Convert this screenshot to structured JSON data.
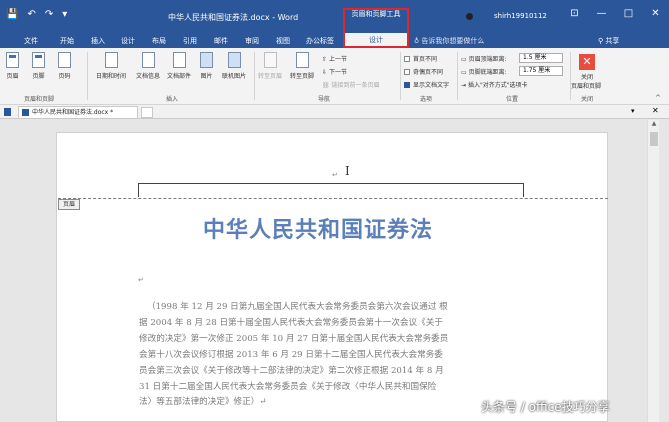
{
  "titlebar": {
    "doc_title": "中华人民共和国证券法.docx - Word",
    "context_group": "页眉和页脚工具",
    "user": "shirh19910112",
    "qat": {
      "save_icon": "💾",
      "undo_icon": "↶",
      "redo_icon": "↷",
      "customize_icon": "▾"
    },
    "win": {
      "ribbon_opt": "⊡",
      "minimize": "—",
      "maximize": "□",
      "close": "✕"
    }
  },
  "tabs": {
    "file": "文件",
    "home": "开始",
    "insert": "插入",
    "design_main": "设计",
    "layout": "布局",
    "references": "引用",
    "mailings": "邮件",
    "review": "审阅",
    "view": "视图",
    "office_tab": "办公标签",
    "design_ctx": "设计",
    "tellme": "告诉我你想要做什么",
    "share": "共享"
  },
  "ribbon": {
    "header_footer": {
      "header": "页眉",
      "footer": "页脚",
      "page_number": "页码",
      "group": "页眉和页脚"
    },
    "insert": {
      "datetime": "日期和时间",
      "docinfo": "文档信息",
      "docparts": "文档部件",
      "picture": "图片",
      "online_picture": "联机图片",
      "group": "插入"
    },
    "nav": {
      "goto_header": "转至页眉",
      "goto_footer": "转至页脚",
      "prev": "上一节",
      "next": "下一节",
      "link_prev": "链接到前一条页眉",
      "group": "导航"
    },
    "options": {
      "diff_first": "首页不同",
      "diff_odd_even": "奇偶页不同",
      "show_text": "显示文档文字",
      "group": "选项"
    },
    "position": {
      "header_top": "页眉顶端距离:",
      "header_top_val": "1.5 厘米",
      "footer_bottom": "页脚底端距离:",
      "footer_bottom_val": "1.75 厘米",
      "align_tab": "插入\"对齐方式\"选项卡",
      "group": "位置"
    },
    "close": {
      "label1": "关闭",
      "label2": "页眉和页脚",
      "group": "关闭"
    },
    "collapse": "^"
  },
  "doctabs": {
    "active": "中华人民共和国证券法.docx *",
    "menu": "▾",
    "close": "✕"
  },
  "document": {
    "header_label": "页眉",
    "cursor": "I",
    "para_mark": "↵",
    "heading": "中华人民共和国证券法",
    "body_lines": [
      "（1998 年 12 月 29 日第九届全国人民代表大会常务委员会第六次会议通过  根",
      "据 2004 年 8 月 28 日第十届全国人民代表大会常务委员会第十一次会议《关于",
      "修改的决定》第一次修正 2005 年 10 月 27 日第十届全国人民代表大会常务委员",
      "会第十八次会议修订根据 2013 年 6 月 29 日第十二届全国人民代表大会常务委",
      "员会第三次会议《关于修改等十二部法律的决定》第二次修正根据 2014 年 8 月",
      "31 日第十二届全国人民代表大会常务委员会《关于修改〈中华人民共和国保险",
      "法〉等五部法律的决定》修正）↵"
    ]
  },
  "watermark": "头条号 / office技巧分享"
}
